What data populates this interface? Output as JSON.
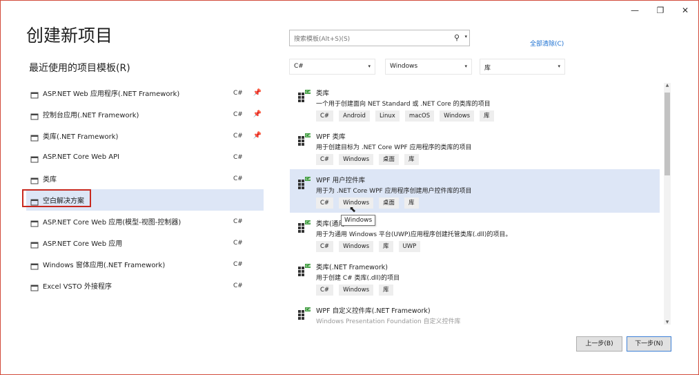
{
  "window": {
    "title": "创建新项目",
    "controls": {
      "minimize": "—",
      "restore": "❐",
      "close": "✕"
    }
  },
  "recent": {
    "title": "最近使用的项目模板(R)",
    "items": [
      {
        "label": "ASP.NET Web 应用程序(.NET Framework)",
        "lang": "C#",
        "pin": "📌",
        "icon": "web-app-icon"
      },
      {
        "label": "控制台应用(.NET Framework)",
        "lang": "C#",
        "pin": "📌",
        "icon": "console-app-icon"
      },
      {
        "label": "类库(.NET Framework)",
        "lang": "C#",
        "pin": "📌",
        "icon": "class-library-icon"
      },
      {
        "label": "ASP.NET Core Web API",
        "lang": "C#",
        "pin": "",
        "icon": "web-api-icon"
      },
      {
        "label": "类库",
        "lang": "C#",
        "pin": "",
        "icon": "class-library-icon"
      },
      {
        "label": "空白解决方案",
        "lang": "",
        "pin": "",
        "icon": "blank-solution-icon",
        "selected": true
      },
      {
        "label": "ASP.NET Core Web 应用(模型-视图-控制器)",
        "lang": "C#",
        "pin": "",
        "icon": "mvc-app-icon"
      },
      {
        "label": "ASP.NET Core Web 应用",
        "lang": "C#",
        "pin": "",
        "icon": "web-app-icon"
      },
      {
        "label": "Windows 窗体应用(.NET Framework)",
        "lang": "C#",
        "pin": "",
        "icon": "winforms-icon"
      },
      {
        "label": "Excel VSTO 外接程序",
        "lang": "C#",
        "pin": "",
        "icon": "excel-icon"
      }
    ]
  },
  "search": {
    "placeholder": "搜索模板(Alt+S)(S)",
    "icon": "search-icon"
  },
  "clear_all": "全部清除(C)",
  "filters": {
    "language": "C#",
    "platform": "Windows",
    "project_type": "库"
  },
  "templates": [
    {
      "name": "类库",
      "desc": "一个用于创建面向 NET Standard 或 .NET Core 的类库的项目",
      "tags": [
        "C#",
        "Android",
        "Linux",
        "macOS",
        "Windows",
        "库"
      ]
    },
    {
      "name": "WPF 类库",
      "desc": "用于创建目标为 .NET Core WPF 应用程序的类库的项目",
      "tags": [
        "C#",
        "Windows",
        "桌面",
        "库"
      ]
    },
    {
      "name": "WPF 用户控件库",
      "desc": "用于为 .NET Core WPF 应用程序创建用户控件库的项目",
      "tags": [
        "C#",
        "Windows",
        "桌面",
        "库"
      ],
      "selected": true
    },
    {
      "name": "类库(通用",
      "desc": "用于为通用 Windows 平台(UWP)应用程序创建托管类库(.dll)的项目。",
      "tags": [
        "C#",
        "Windows",
        "库",
        "UWP"
      ]
    },
    {
      "name": "类库(.NET Framework)",
      "desc": "用于创建 C# 类库(.dll)的项目",
      "tags": [
        "C#",
        "Windows",
        "库"
      ]
    },
    {
      "name": "WPF 自定义控件库(.NET Framework)",
      "desc": "Windows Presentation Foundation 自定义控件库",
      "tags": []
    }
  ],
  "tooltip": "Windows",
  "buttons": {
    "back": "上一步(B)",
    "next": "下一步(N)"
  },
  "colors": {
    "accent": "#1a6fd1",
    "selection": "#dde6f6",
    "highlight_border": "#c8281e"
  }
}
